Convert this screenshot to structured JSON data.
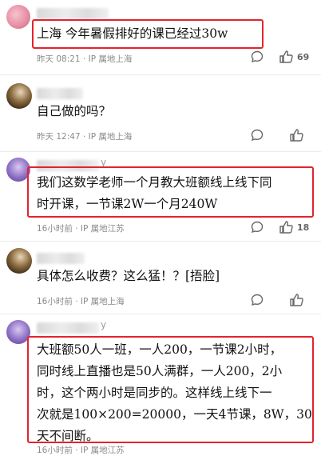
{
  "comments": [
    {
      "text": "上海 今年暑假排好的课已经过30w",
      "time": "昨天 08:21",
      "ip": "IP 属地上海",
      "likes": "69"
    },
    {
      "text": "自己做的吗？",
      "time": "昨天 12:47",
      "ip": "IP 属地上海",
      "likes": ""
    },
    {
      "name_suffix": "y",
      "text": "我们这数学老师一个月教大班额线上线下同\n时开课，一节课2W一个月240W",
      "time": "16小时前",
      "ip": "IP 属地江苏",
      "likes": "18"
    },
    {
      "text": "具体怎么收费？这么猛！？[捂脸]",
      "time": "16小时前",
      "ip": "IP 属地上海",
      "likes": ""
    },
    {
      "name_suffix": "y",
      "text": "大班额50人一班，一人200，一节课2小时，\n同时线上直播也是50人满群，一人200，2小\n时，这个两小时是同步的。这样线上线下一\n次就是100×200=20000，一天4节课，8W，30\n天不间断。",
      "time": "16小时前",
      "ip": "IP 属地江苏",
      "likes": ""
    }
  ],
  "colors": {
    "highlight": "#e3232d",
    "meta": "#8a8a8a",
    "divider": "#ececec"
  },
  "icons": [
    "comment-bubble-icon",
    "thumb-up-icon"
  ]
}
